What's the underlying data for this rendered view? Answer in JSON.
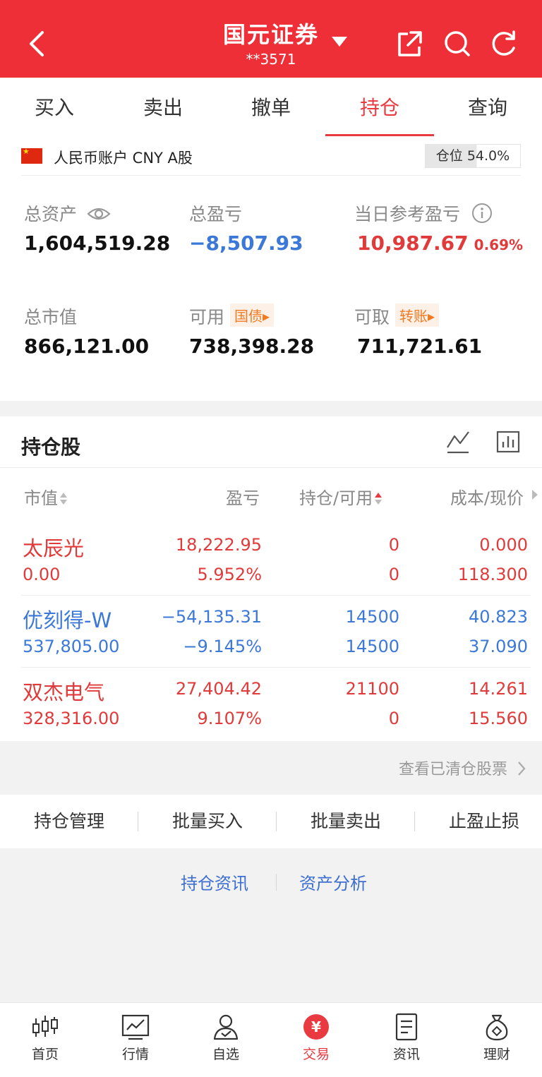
{
  "header": {
    "title": "国元证券",
    "subtitle": "**3571"
  },
  "tabs": [
    {
      "label": "买入"
    },
    {
      "label": "卖出"
    },
    {
      "label": "撤单"
    },
    {
      "label": "持仓",
      "active": true
    },
    {
      "label": "查询"
    }
  ],
  "account": {
    "label": "人民币账户 CNY A股",
    "position_text": "仓位 54.0%",
    "position_ratio": 0.54,
    "total_assets_label": "总资产",
    "total_assets": "1,604,519.28",
    "total_pl_label": "总盈亏",
    "total_pl": "−8,507.93",
    "daily_pl_label": "当日参考盈亏",
    "daily_pl": "10,987.67",
    "daily_pl_pct": "0.69%",
    "market_value_label": "总市值",
    "market_value": "866,121.00",
    "available_label": "可用",
    "available_tag": "国债▸",
    "available": "738,398.28",
    "withdrawable_label": "可取",
    "withdrawable_tag": "转账▸",
    "withdrawable": "711,721.61"
  },
  "holdings": {
    "title": "持仓股",
    "columns": [
      "市值",
      "盈亏",
      "持仓/可用",
      "成本/现价"
    ],
    "rows": [
      {
        "name": "太辰光",
        "market_value": "0.00",
        "pl": "18,222.95",
        "pl_pct": "5.952%",
        "position": "0",
        "available": "0",
        "cost": "0.000",
        "price": "118.300",
        "color": "red"
      },
      {
        "name": "优刻得-W",
        "market_value": "537,805.00",
        "pl": "−54,135.31",
        "pl_pct": "−9.145%",
        "position": "14500",
        "available": "14500",
        "cost": "40.823",
        "price": "37.090",
        "color": "blue"
      },
      {
        "name": "双杰电气",
        "market_value": "328,316.00",
        "pl": "27,404.42",
        "pl_pct": "9.107%",
        "position": "21100",
        "available": "0",
        "cost": "14.261",
        "price": "15.560",
        "color": "red"
      }
    ],
    "clear_link": "查看已清仓股票"
  },
  "actions": [
    "持仓管理",
    "批量买入",
    "批量卖出",
    "止盈止损"
  ],
  "links": [
    "持仓资讯",
    "资产分析"
  ],
  "nav": [
    {
      "label": "首页",
      "icon": "candlestick-icon"
    },
    {
      "label": "行情",
      "icon": "chart-icon"
    },
    {
      "label": "自选",
      "icon": "person-check-icon"
    },
    {
      "label": "交易",
      "icon": "yuan-icon",
      "active": true
    },
    {
      "label": "资讯",
      "icon": "document-icon"
    },
    {
      "label": "理财",
      "icon": "money-bag-icon"
    }
  ],
  "colors": {
    "brand": "#ee2f38",
    "gain": "#e03a3a",
    "loss": "#3c78d8",
    "tag": "#f07a23"
  }
}
